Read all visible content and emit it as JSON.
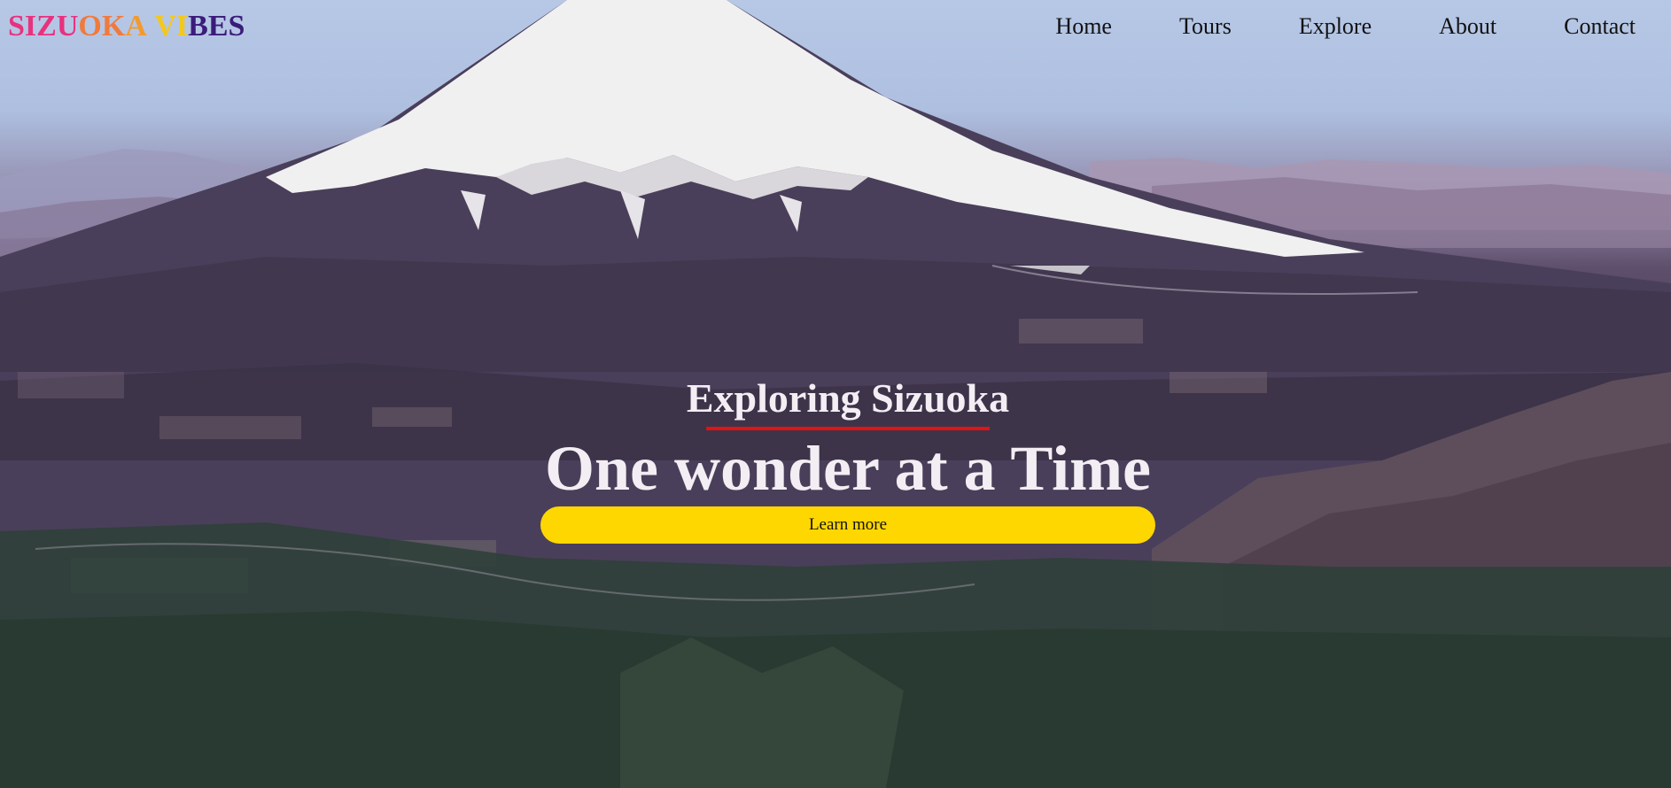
{
  "brand": {
    "letters": [
      {
        "char": "S",
        "color": "#e8327e"
      },
      {
        "char": "I",
        "color": "#e8327e"
      },
      {
        "char": "Z",
        "color": "#e8327e"
      },
      {
        "char": "U",
        "color": "#e8327e"
      },
      {
        "char": "O",
        "color": "#f07a3c"
      },
      {
        "char": "K",
        "color": "#f07a3c"
      },
      {
        "char": "A",
        "color": "#f39a2e"
      },
      {
        "char": " ",
        "color": "#000000"
      },
      {
        "char": "V",
        "color": "#f3c81e"
      },
      {
        "char": "I",
        "color": "#f3c81e"
      },
      {
        "char": "B",
        "color": "#3a1c7a"
      },
      {
        "char": "E",
        "color": "#3a1c7a"
      },
      {
        "char": "S",
        "color": "#3a1c7a"
      }
    ]
  },
  "nav": {
    "items": [
      {
        "label": "Home"
      },
      {
        "label": "Tours"
      },
      {
        "label": "Explore"
      },
      {
        "label": "About"
      },
      {
        "label": "Contact"
      }
    ]
  },
  "hero": {
    "subtitle": "Exploring Sizuoka",
    "headline": "One wonder at a Time",
    "cta_label": "Learn more",
    "background_image": "mount-fuji-aerial-photo",
    "accent_color": "#ffd700",
    "underline_color": "#e31212"
  }
}
